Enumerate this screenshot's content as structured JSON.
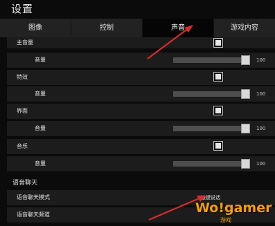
{
  "window": {
    "title": "设置"
  },
  "tabs": [
    {
      "label": "图像"
    },
    {
      "label": "控制"
    },
    {
      "label": "声音"
    },
    {
      "label": "游戏内容"
    }
  ],
  "rows": [
    {
      "label": "主音量",
      "type": "toggle",
      "checked": true
    },
    {
      "label": "音量",
      "type": "slider",
      "value": "100",
      "level": 1.0
    },
    {
      "label": "特效",
      "type": "toggle",
      "checked": true
    },
    {
      "label": "音量",
      "type": "slider",
      "value": "100",
      "level": 1.0
    },
    {
      "label": "界面",
      "type": "toggle",
      "checked": true
    },
    {
      "label": "音量",
      "type": "slider",
      "value": "100",
      "level": 1.0
    },
    {
      "label": "音乐",
      "type": "toggle",
      "checked": true
    },
    {
      "label": "音量",
      "type": "slider",
      "value": "100",
      "level": 1.0
    }
  ],
  "voice_chat": {
    "section_title": "语音聊天",
    "mode_label": "语音聊天模式",
    "mode_value": "按键说话",
    "channel_label": "语音聊天频道"
  },
  "watermark": {
    "text": "Wo!gamer",
    "sub": "游戏"
  },
  "colors": {
    "arrow": "#d92b2b",
    "logo": "#f5a000"
  }
}
